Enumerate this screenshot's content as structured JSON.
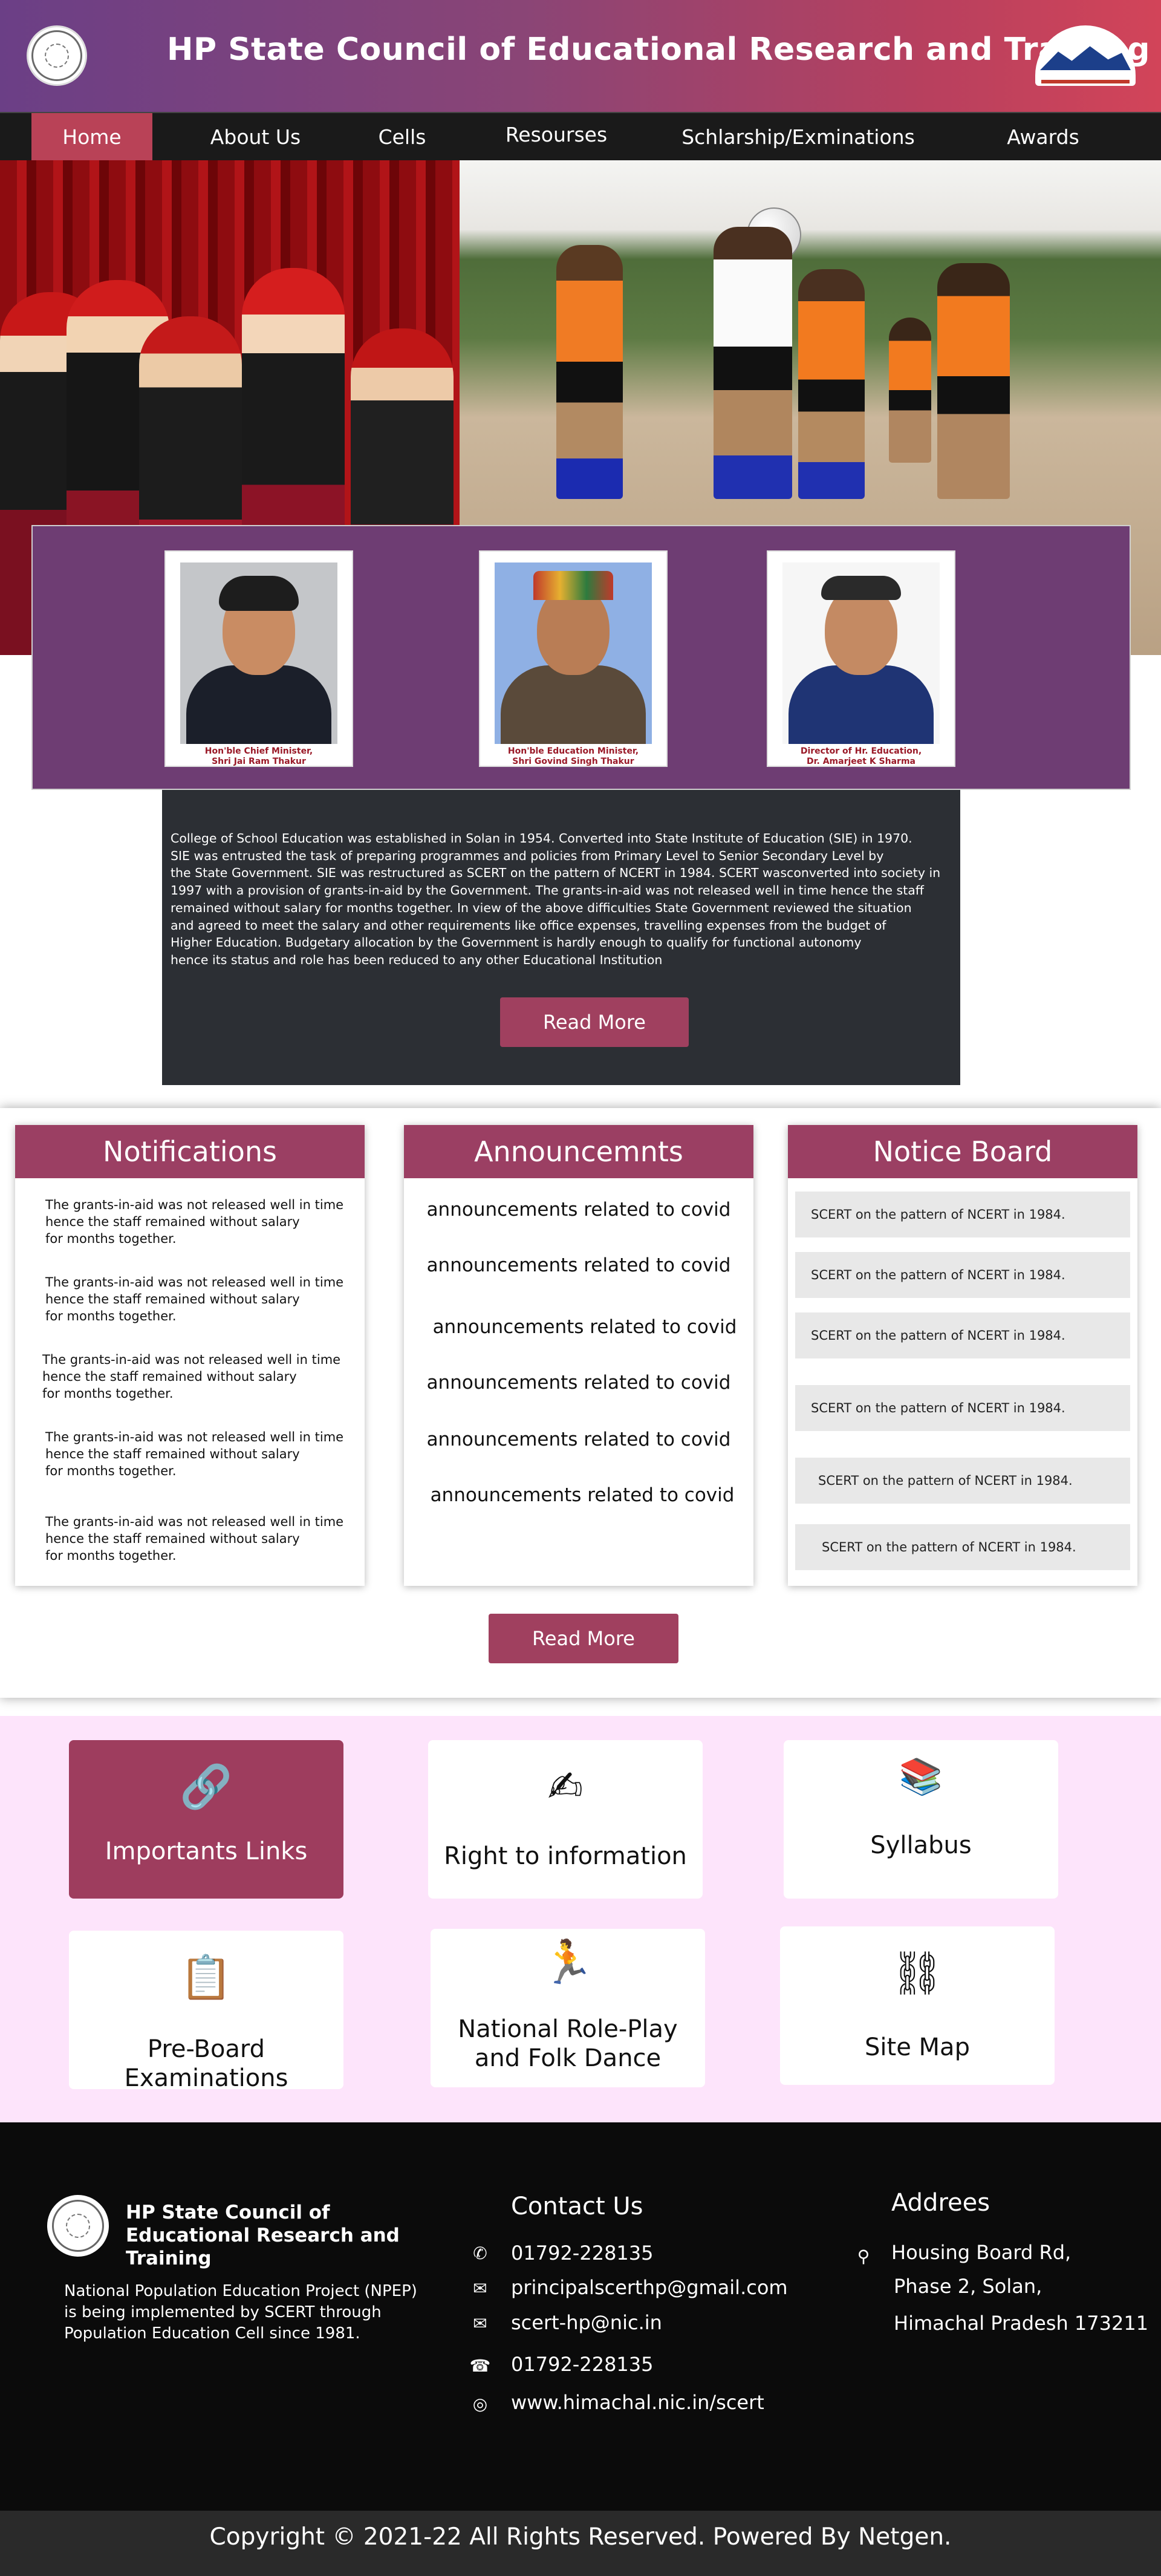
{
  "header": {
    "title": "HP State Council of Educational Research and Training"
  },
  "nav": {
    "items": [
      "Home",
      "About Us",
      "Cells",
      "Resourses",
      "Schlarship/Exminations",
      "Awards"
    ],
    "active": "Home"
  },
  "leaders": [
    {
      "caption_line1": "Hon'ble Chief Minister,",
      "caption_line2": "Shri Jai Ram Thakur"
    },
    {
      "caption_line1": "Hon'ble Education Minister,",
      "caption_line2": "Shri Govind Singh Thakur"
    },
    {
      "caption_line1": "Director of Hr. Education,",
      "caption_line2": "Dr. Amarjeet K Sharma"
    }
  ],
  "intro": {
    "text": "College of School Education was established in Solan in 1954. Converted into State Institute of Education (SIE) in 1970.\nSIE was entrusted the task of preparing programmes and policies from Primary Level to Senior Secondary Level by\nthe State Government. SIE was restructured as SCERT on the pattern of NCERT in 1984. SCERT wasconverted into society in\n1997 with a provision of grants-in-aid by the Government. The grants-in-aid was not released well in time hence the staff\nremained without salary for months together. In view of the above difficulties State Government reviewed the situation\nand agreed to meet the salary and other requirements like office expenses, travelling expenses from the budget of\n Higher Education. Budgetary allocation by the Government is hardly enough to qualify for functional autonomy\nhence its status and role has been reduced to any other Educational Institution",
    "read_more": "Read More"
  },
  "boards": {
    "notifications": {
      "title": "Notifications",
      "items": [
        "The grants-in-aid was not released well in time\nhence the staff remained without salary\nfor months together.",
        "The grants-in-aid was not released well in time\nhence the staff remained without salary\nfor months together.",
        "The grants-in-aid was not released well in time\nhence the staff remained without salary\nfor months together.",
        "The grants-in-aid was not released well in time\nhence the staff remained without salary\nfor months together.",
        "The grants-in-aid was not released well in time\nhence the staff remained without salary\nfor months together."
      ]
    },
    "announcements": {
      "title": "Announcemnts",
      "items": [
        "announcements related to covid",
        "announcements related to covid",
        "announcements related to covid",
        "announcements related to covid",
        "announcements related to covid",
        "announcements related to covid"
      ]
    },
    "notice_board": {
      "title": "Notice Board",
      "items": [
        "SCERT on the pattern of NCERT in 1984.",
        "SCERT on the pattern of NCERT in 1984.",
        "SCERT on the pattern of NCERT in 1984.",
        "SCERT on the pattern of NCERT in 1984.",
        "SCERT on the pattern of NCERT in 1984.",
        "SCERT on the pattern of NCERT in 1984."
      ]
    },
    "read_more": "Read More"
  },
  "quick_links": [
    {
      "label": "Importants Links",
      "icon": "link-icon",
      "glyph": "🔗"
    },
    {
      "label": "Right to information",
      "icon": "pen-hand-icon",
      "glyph": "✍"
    },
    {
      "label": "Syllabus",
      "icon": "books-icon",
      "glyph": "📚"
    },
    {
      "label": "Pre-Board Examinations",
      "icon": "exam-document-icon",
      "glyph": "📋"
    },
    {
      "label": "National Role-Play and Folk Dance",
      "icon": "running-person-icon",
      "glyph": "🏃"
    },
    {
      "label": "Site Map",
      "icon": "sitemap-icon",
      "glyph": "⛓"
    }
  ],
  "footer": {
    "org_name": "HP State Council of Educational Research and Training",
    "description": "National Population Education Project (NPEP) is being implemented by SCERT through Population Education Cell since 1981.",
    "contact_heading": "Contact Us",
    "phone": "01792-228135",
    "email1": "principalscerthp@gmail.com",
    "email2": "scert-hp@nic.in",
    "fax": "01792-228135",
    "website": "www.himachal.nic.in/scert",
    "address_heading": "Addrees",
    "address_line1": "Housing Board Rd,",
    "address_line2": "Phase 2, Solan,",
    "address_line3": "Himachal Pradesh 173211",
    "copyright": "Copyright © 2021-22 All Rights Reserved. Powered By Netgen."
  },
  "colors": {
    "header_gradient_start": "#6b3f86",
    "header_gradient_end": "#d24459",
    "accent_pink": "#9e3d5e",
    "nav_active": "#b94257",
    "panel_purple": "#6e3d73",
    "quick_bg": "#fde4fb"
  }
}
